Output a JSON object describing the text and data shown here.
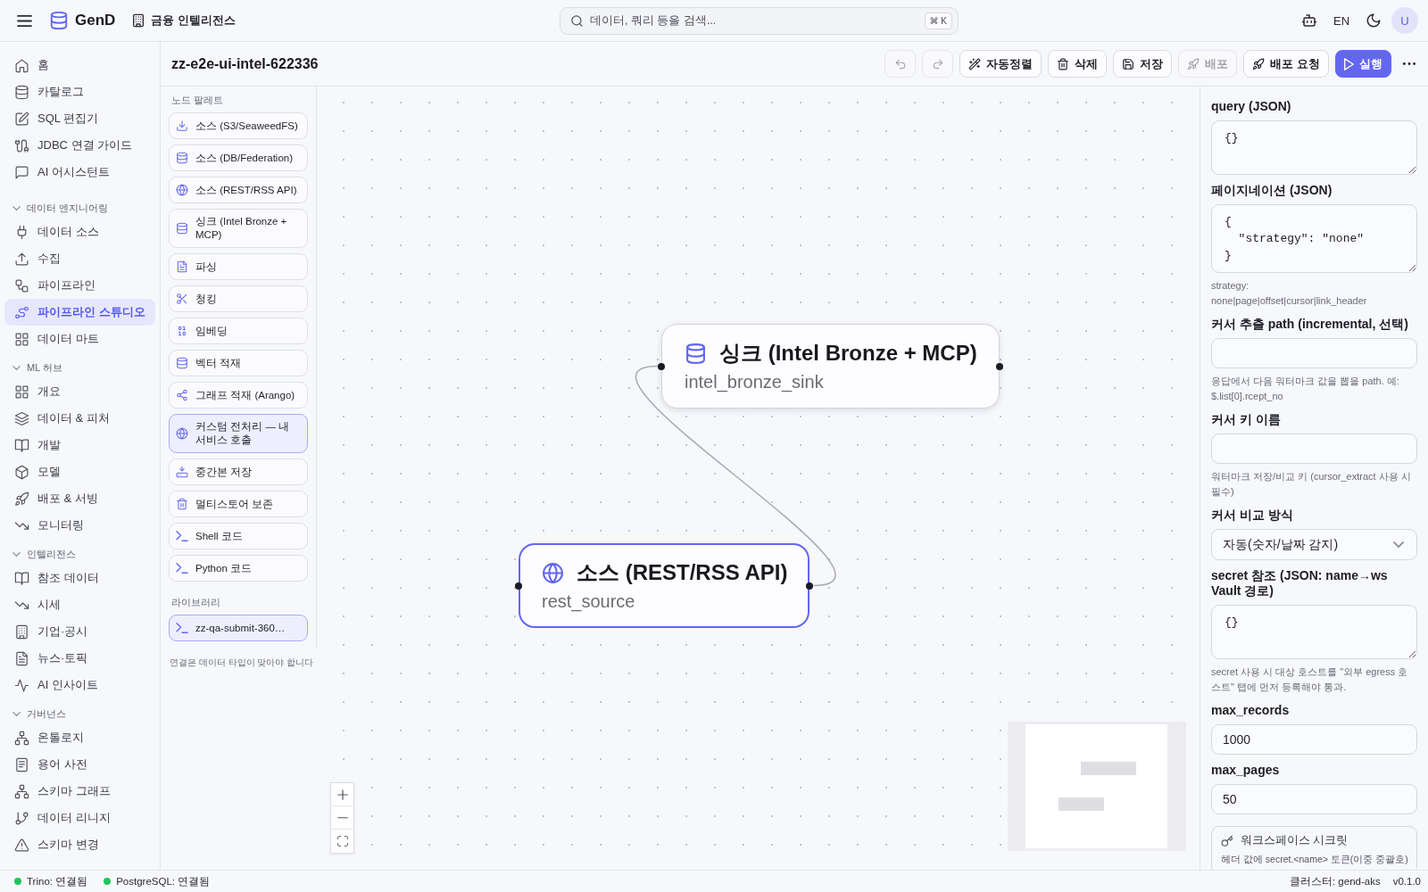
{
  "top_bar": {
    "app_name": "GenD",
    "workspace": "금융 인텔리전스",
    "search": {
      "placeholder": "데이터, 쿼리 등을 검색...",
      "shortcut": "⌘ K"
    },
    "language": "EN",
    "avatar": "U"
  },
  "sidebar": {
    "items": [
      {
        "label": "홈",
        "selected": false
      },
      {
        "label": "카탈로그",
        "selected": false
      },
      {
        "label": "SQL 편집기",
        "selected": false
      },
      {
        "label": "JDBC 연결 가이드",
        "selected": false
      },
      {
        "label": "AI 어시스턴트",
        "selected": false
      }
    ],
    "sections": [
      {
        "title": "데이터 엔지니어링",
        "expanded": true,
        "items": [
          {
            "label": "데이터 소스",
            "selected": false
          },
          {
            "label": "수집",
            "selected": false
          },
          {
            "label": "파이프라인",
            "selected": false
          },
          {
            "label": "파이프라인 스튜디오",
            "selected": true
          },
          {
            "label": "데이터 마트",
            "selected": false
          }
        ]
      },
      {
        "title": "ML 허브",
        "expanded": true,
        "items": [
          {
            "label": "개요",
            "selected": false
          },
          {
            "label": "데이터 & 피처",
            "selected": false
          },
          {
            "label": "개발",
            "selected": false
          },
          {
            "label": "모델",
            "selected": false
          },
          {
            "label": "배포 & 서빙",
            "selected": false
          },
          {
            "label": "모니터링",
            "selected": false
          }
        ]
      },
      {
        "title": "인텔리전스",
        "expanded": true,
        "items": [
          {
            "label": "참조 데이터",
            "selected": false
          },
          {
            "label": "시세",
            "selected": false
          },
          {
            "label": "기업·공시",
            "selected": false
          },
          {
            "label": "뉴스·토픽",
            "selected": false
          },
          {
            "label": "AI 인사이트",
            "selected": false
          }
        ]
      },
      {
        "title": "거버넌스",
        "expanded": true,
        "items": [
          {
            "label": "온톨로지",
            "selected": false
          },
          {
            "label": "용어 사전",
            "selected": false
          },
          {
            "label": "스키마 그래프",
            "selected": false
          },
          {
            "label": "데이터 리니지",
            "selected": false
          },
          {
            "label": "스키마 변경",
            "selected": false
          }
        ]
      }
    ]
  },
  "pipeline": {
    "title": "zz-e2e-ui-intel-622336",
    "toolbar": [
      {
        "kind": "icon",
        "disabled": true
      },
      {
        "kind": "icon",
        "disabled": true
      },
      {
        "kind": "default",
        "label": "자동정렬",
        "disabled": false
      },
      {
        "kind": "default",
        "label": "삭제",
        "disabled": false
      },
      {
        "kind": "default",
        "label": "저장",
        "disabled": false
      },
      {
        "kind": "default",
        "label": "배포",
        "disabled": true
      },
      {
        "kind": "default",
        "label": "배포 요청",
        "disabled": false
      },
      {
        "kind": "primary",
        "label": "실행",
        "disabled": false
      },
      {
        "kind": "menu",
        "disabled": false
      }
    ]
  },
  "palette": {
    "title": "노드 팔레트",
    "items": [
      {
        "label": "소스 (S3/SeaweedFS)",
        "kind": "builtin"
      },
      {
        "label": "소스 (DB/Federation)",
        "kind": "builtin"
      },
      {
        "label": "소스 (REST/RSS API)",
        "kind": "builtin"
      },
      {
        "label": "싱크 (Intel Bronze + MCP)",
        "kind": "builtin"
      },
      {
        "label": "파싱",
        "kind": "builtin"
      },
      {
        "label": "청킹",
        "kind": "builtin"
      },
      {
        "label": "임베딩",
        "kind": "builtin"
      },
      {
        "label": "벡터 적재",
        "kind": "builtin"
      },
      {
        "label": "그래프 적재 (Arango)",
        "kind": "builtin"
      },
      {
        "label": "커스텀 전처리 — 내 서비스 호출",
        "kind": "custom"
      },
      {
        "label": "중간본 저장",
        "kind": "builtin"
      },
      {
        "label": "멀티스토어 보존",
        "kind": "builtin"
      },
      {
        "label": "Shell 코드",
        "kind": "builtin"
      },
      {
        "label": "Python 코드",
        "kind": "builtin"
      }
    ],
    "library_title": "라이브러리",
    "library_items": [
      {
        "label": "zz-qa-submit-360…",
        "kind": "custom"
      }
    ],
    "footer": "연결은 데이터 타입이 맞아야 합니다"
  },
  "canvas": {
    "nodes": [
      {
        "title": "싱크 (Intel Bronze + MCP)",
        "name": "intel_bronze_sink",
        "selected": false
      },
      {
        "title": "소스 (REST/RSS API)",
        "name": "rest_source",
        "selected": true
      }
    ]
  },
  "properties": {
    "fields": [
      {
        "kind": "textarea",
        "label": "query (JSON)",
        "value": "{}"
      },
      {
        "kind": "textarea",
        "label": "페이지네이션 (JSON)",
        "value": "{\n  \"strategy\": \"none\"\n}",
        "hint": "strategy:\nnone|page|offset|cursor|link_header"
      },
      {
        "kind": "input",
        "label": "커서 추출 path (incremental, 선택)",
        "hint": "응답에서 다음 워터마크 값을 뽑을 path. 예: $.list[0].rcept_no"
      },
      {
        "kind": "input",
        "label": "커서 키 이름",
        "hint": "워터마크 저장/비교 키 (cursor_extract 사용 시 필수)"
      },
      {
        "kind": "select",
        "label": "커서 비교 방식",
        "value": "자동(숫자/날짜 감지)"
      },
      {
        "kind": "textarea",
        "label": "secret 참조 (JSON: name→ws Vault 경로)",
        "value": "{}",
        "hint": "secret 사용 시 대상 호스트를 \"외부 egress 호스트\" 탭에 먼저 등록해야 통과."
      },
      {
        "kind": "input",
        "label": "max_records",
        "value": "1000"
      },
      {
        "kind": "input",
        "label": "max_pages",
        "value": "50"
      }
    ],
    "secrets_card": {
      "title": "워크스페이스 시크릿",
      "text": "헤더 값에 secret.<name> 토큰(이중 중괄호)"
    }
  },
  "status_bar": {
    "connections": [
      {
        "label": "Trino: 연결됨",
        "connected": true
      },
      {
        "label": "PostgreSQL: 연결됨",
        "connected": true
      }
    ],
    "cluster": "클러스터: gend-aks",
    "version": "v0.1.0"
  }
}
